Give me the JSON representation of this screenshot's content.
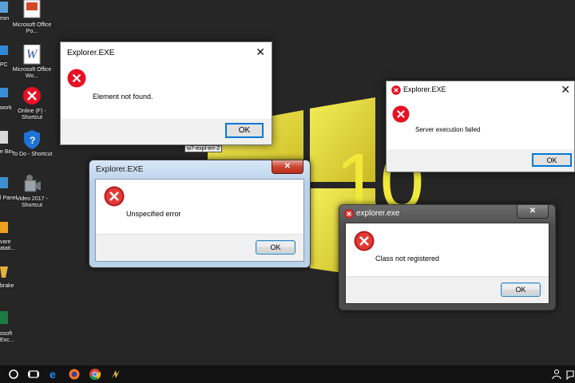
{
  "desktop": {
    "icons": [
      {
        "label": "Microsoft Office Po...",
        "icon": "powerpoint-icon"
      },
      {
        "label": "Microsoft Office Wo...",
        "icon": "word-icon"
      },
      {
        "label": "Online (F) - Shortcut",
        "icon": "error-shortcut-icon"
      },
      {
        "label": "To Do - Shortcut",
        "icon": "shield-icon"
      },
      {
        "label": "Video 2017 - Shortcut",
        "icon": "video-icon"
      }
    ],
    "left_labels": [
      "min",
      "PC",
      "work",
      "e Bin",
      "l Panel",
      "vare",
      "atati...",
      "brake",
      "osoft",
      "Exc..."
    ],
    "taskbar_tooltip": "w7-expl-err-2",
    "wallpaper_text": "10",
    "colors": {
      "wallpaper": "#262626",
      "logo_yellow": "#e8e03a",
      "error_red": "#e81123"
    }
  },
  "dialogs": {
    "d1": {
      "title": "Explorer.EXE",
      "message": "Element not found.",
      "ok": "OK",
      "close": "✕"
    },
    "d2": {
      "title": "Explorer.EXE",
      "message": "Server execution failed",
      "ok": "OK",
      "close": "✕"
    },
    "d3": {
      "title": "Explorer.EXE",
      "message": "Unspecified error",
      "ok": "OK",
      "close": "✕"
    },
    "d4": {
      "title": "explorer.exe",
      "message": "Class not registered",
      "ok": "OK",
      "close": "✕"
    }
  },
  "taskbar": {
    "items": [
      "start-icon",
      "task-view-icon",
      "edge-icon",
      "firefox-icon",
      "chrome-icon",
      "winamp-icon"
    ]
  }
}
